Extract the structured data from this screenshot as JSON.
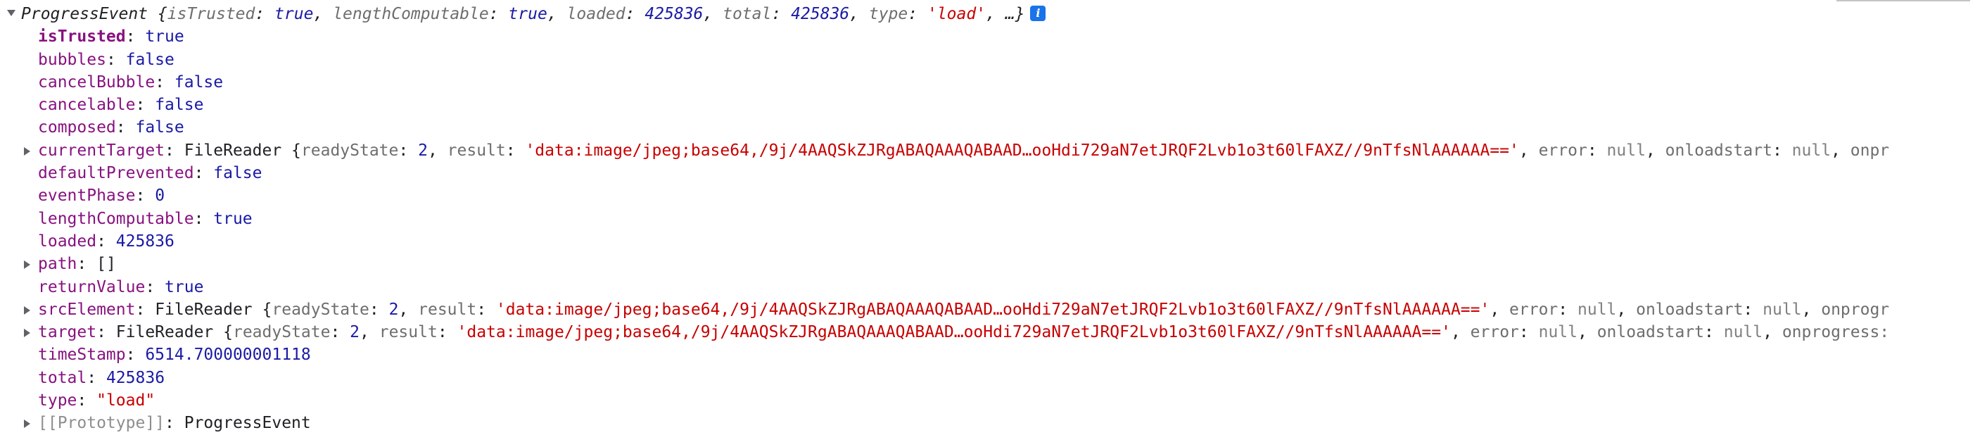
{
  "header": {
    "class_name": "ProgressEvent",
    "open_brace": "{",
    "summary_props": [
      {
        "key": "isTrusted",
        "value": "true"
      },
      {
        "key": "lengthComputable",
        "value": "true"
      },
      {
        "key": "loaded",
        "value": "425836"
      },
      {
        "key": "total",
        "value": "425836"
      },
      {
        "key": "type",
        "value": "'load'"
      }
    ],
    "ellipsis": "…}",
    "info_icon_glyph": "i"
  },
  "props": [
    {
      "key": "isTrusted",
      "value": "true"
    },
    {
      "key": "bubbles",
      "value": "false"
    },
    {
      "key": "cancelBubble",
      "value": "false"
    },
    {
      "key": "cancelable",
      "value": "false"
    },
    {
      "key": "composed",
      "value": "false"
    },
    {
      "key": "currentTarget",
      "class_name": "FileReader",
      "ready_key": "readyState",
      "ready_value": "2",
      "result_key": "result",
      "result_value": "'data:image/jpeg;base64,/9j/4AAQSkZJRgABAQAAAQABAAD…ooHdi729aN7etJRQF2Lvb1o3t60lFAXZ//9nTfsNlAAAAAA=='",
      "error_key": "error",
      "error_value": "null",
      "onloadstart_key": "onloadstart",
      "onloadstart_value": "null",
      "tail": "onpr"
    },
    {
      "key": "defaultPrevented",
      "value": "false"
    },
    {
      "key": "eventPhase",
      "value": "0"
    },
    {
      "key": "lengthComputable",
      "value": "true"
    },
    {
      "key": "loaded",
      "value": "425836"
    },
    {
      "key": "path",
      "value": "[]"
    },
    {
      "key": "returnValue",
      "value": "true"
    },
    {
      "key": "srcElement",
      "class_name": "FileReader",
      "ready_key": "readyState",
      "ready_value": "2",
      "result_key": "result",
      "result_value": "'data:image/jpeg;base64,/9j/4AAQSkZJRgABAQAAAQABAAD…ooHdi729aN7etJRQF2Lvb1o3t60lFAXZ//9nTfsNlAAAAAA=='",
      "error_key": "error",
      "error_value": "null",
      "onloadstart_key": "onloadstart",
      "onloadstart_value": "null",
      "tail": "onprogr"
    },
    {
      "key": "target",
      "class_name": "FileReader",
      "ready_key": "readyState",
      "ready_value": "2",
      "result_key": "result",
      "result_value": "'data:image/jpeg;base64,/9j/4AAQSkZJRgABAQAAAQABAAD…ooHdi729aN7etJRQF2Lvb1o3t60lFAXZ//9nTfsNlAAAAAA=='",
      "error_key": "error",
      "error_value": "null",
      "onloadstart_key": "onloadstart",
      "onloadstart_value": "null",
      "tail": "onprogress:"
    },
    {
      "key": "timeStamp",
      "value": "6514.700000001118"
    },
    {
      "key": "total",
      "value": "425836"
    },
    {
      "key": "type",
      "value": "\"load\""
    },
    {
      "key": "[[Prototype]]",
      "value": "ProgressEvent"
    }
  ],
  "colors": {
    "key_purple": "#881280",
    "number_blue": "#1a1aa6",
    "string_red": "#c80000",
    "null_grey": "#808080",
    "info_blue": "#1a73e8"
  }
}
